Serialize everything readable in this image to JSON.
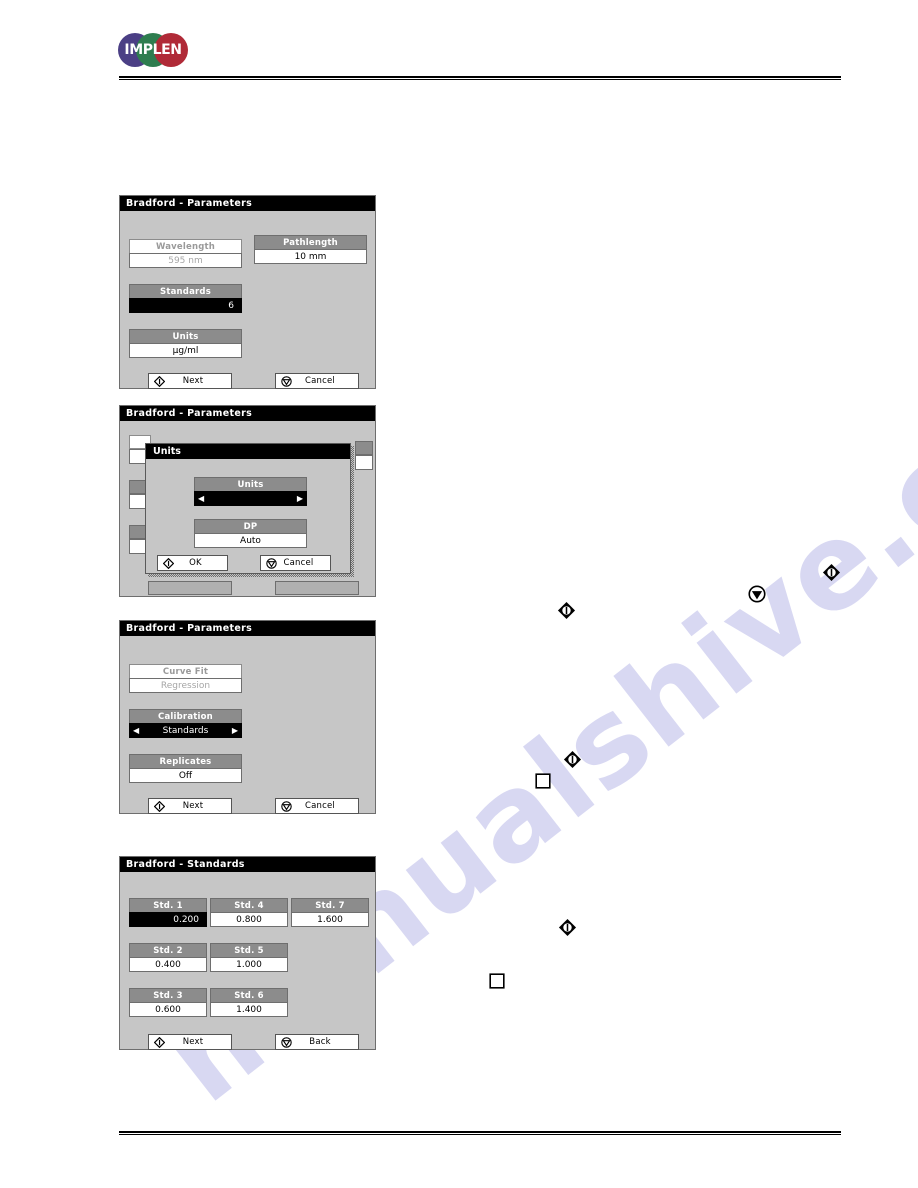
{
  "brand": {
    "logo_text": "IMPLEN",
    "colors": {
      "circle_purple": "#4b3f85",
      "circle_green": "#2e7d4f",
      "circle_red": "#b02a37"
    }
  },
  "watermark": {
    "text": "manualshive.com"
  },
  "screens": [
    {
      "id": "parameters-1",
      "title": "Bradford - Parameters",
      "fields": [
        {
          "name": "wavelength",
          "label": "Wavelength",
          "value": "595 nm",
          "label_state": "off",
          "value_state": "dim"
        },
        {
          "name": "pathlength",
          "label": "Pathlength",
          "value": "10 mm",
          "label_state": "on",
          "value_state": "normal"
        },
        {
          "name": "standards",
          "label": "Standards",
          "value": "6",
          "label_state": "on",
          "value_state": "selected"
        },
        {
          "name": "units",
          "label": "Units",
          "value": "µg/ml",
          "label_state": "on",
          "value_state": "normal"
        }
      ],
      "buttons": [
        {
          "name": "next",
          "label": "Next",
          "icon": "diamond-enter-icon"
        },
        {
          "name": "cancel",
          "label": "Cancel",
          "icon": "circle-cancel-icon"
        }
      ]
    },
    {
      "id": "parameters-units-modal",
      "title": "Bradford - Parameters",
      "modal": {
        "title": "Units",
        "fields": [
          {
            "name": "units",
            "label": "Units",
            "value": "",
            "label_state": "on",
            "value_state": "selected",
            "has_arrows": true
          },
          {
            "name": "dp",
            "label": "DP",
            "value": "Auto",
            "label_state": "on",
            "value_state": "normal",
            "has_arrows": false
          }
        ],
        "buttons": [
          {
            "name": "ok",
            "label": "OK",
            "icon": "diamond-enter-icon"
          },
          {
            "name": "cancel",
            "label": "Cancel",
            "icon": "circle-cancel-icon"
          }
        ]
      }
    },
    {
      "id": "parameters-2",
      "title": "Bradford - Parameters",
      "fields": [
        {
          "name": "curve-fit",
          "label": "Curve Fit",
          "value": "Regression",
          "label_state": "off",
          "value_state": "dim"
        },
        {
          "name": "calibration",
          "label": "Calibration",
          "value": "Standards",
          "label_state": "on",
          "value_state": "selected",
          "has_arrows": true
        },
        {
          "name": "replicates",
          "label": "Replicates",
          "value": "Off",
          "label_state": "on",
          "value_state": "normal"
        }
      ],
      "buttons": [
        {
          "name": "next",
          "label": "Next",
          "icon": "diamond-enter-icon"
        },
        {
          "name": "cancel",
          "label": "Cancel",
          "icon": "circle-cancel-icon"
        }
      ]
    },
    {
      "id": "standards",
      "title": "Bradford - Standards",
      "fields": [
        {
          "name": "std-1",
          "label": "Std. 1",
          "value": "0.200",
          "label_state": "on",
          "value_state": "selected"
        },
        {
          "name": "std-2",
          "label": "Std. 2",
          "value": "0.400",
          "label_state": "on",
          "value_state": "normal"
        },
        {
          "name": "std-3",
          "label": "Std. 3",
          "value": "0.600",
          "label_state": "on",
          "value_state": "normal"
        },
        {
          "name": "std-4",
          "label": "Std. 4",
          "value": "0.800",
          "label_state": "on",
          "value_state": "normal"
        },
        {
          "name": "std-5",
          "label": "Std. 5",
          "value": "1.000",
          "label_state": "on",
          "value_state": "normal"
        },
        {
          "name": "std-6",
          "label": "Std. 6",
          "value": "1.400",
          "label_state": "on",
          "value_state": "normal"
        },
        {
          "name": "std-7",
          "label": "Std. 7",
          "value": "1.600",
          "label_state": "on",
          "value_state": "normal"
        }
      ],
      "buttons": [
        {
          "name": "next",
          "label": "Next",
          "icon": "diamond-enter-icon"
        },
        {
          "name": "back",
          "label": "Back",
          "icon": "circle-cancel-icon"
        }
      ]
    }
  ],
  "inline_keys": [
    {
      "name": "enter-key-icon-a",
      "icon": "diamond-enter-filled-icon"
    },
    {
      "name": "cancel-key-icon-a",
      "icon": "circle-cancel-icon"
    },
    {
      "name": "enter-key-icon-b",
      "icon": "diamond-enter-filled-icon"
    },
    {
      "name": "enter-key-icon-c",
      "icon": "diamond-enter-filled-icon"
    },
    {
      "name": "blank-key-icon-a",
      "icon": "square-key-icon"
    },
    {
      "name": "enter-key-icon-d",
      "icon": "diamond-enter-filled-icon"
    },
    {
      "name": "blank-key-icon-b",
      "icon": "square-key-icon"
    }
  ]
}
